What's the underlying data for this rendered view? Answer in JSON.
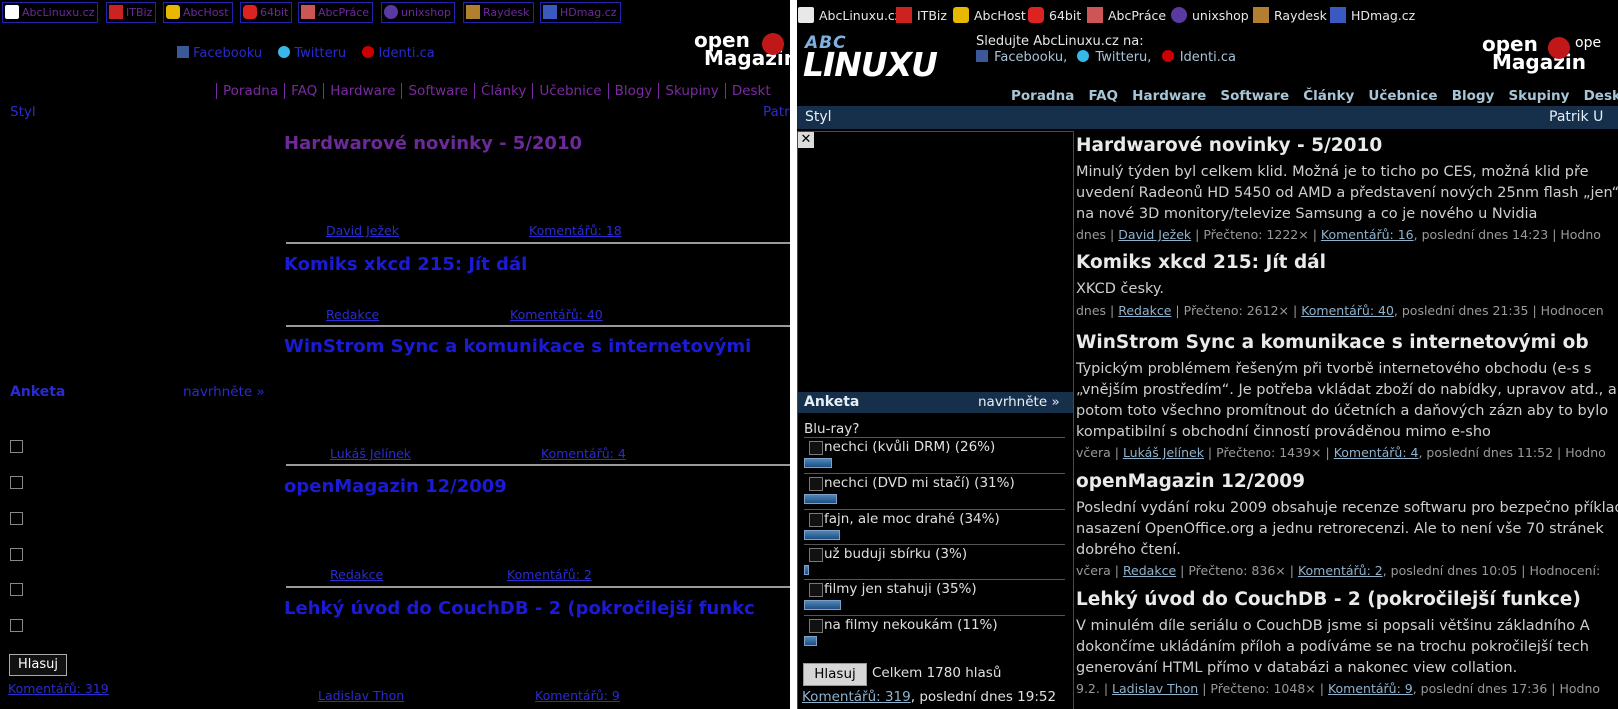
{
  "toolbar": [
    {
      "label": "AbcLinuxu.cz",
      "icon": "abclinuxu-icon"
    },
    {
      "label": "ITBiz",
      "icon": "itbiz-icon"
    },
    {
      "label": "AbcHost",
      "icon": "lock-icon"
    },
    {
      "label": "64bit",
      "icon": "64bit-icon"
    },
    {
      "label": "AbcPráce",
      "icon": "eraser-icon"
    },
    {
      "label": "unixshop",
      "icon": "unixshop-icon"
    },
    {
      "label": "Raydesk",
      "icon": "raydesk-icon"
    },
    {
      "label": "HDmag.cz",
      "icon": "hdmag-icon"
    }
  ],
  "header": {
    "follow_text": "Sledujte AbcLinuxu.cz na:",
    "facebook": "Facebooku,",
    "twitter": "Twitteru,",
    "identica": "Identi.ca",
    "facebook_left": "Facebooku",
    "twitter_left": "Twitteru",
    "openmag_line1": "open",
    "openmag_line2": "Magazin",
    "openmag_cut": "ope",
    "logo_abc": "ABC",
    "logo_linux": "LINUXU"
  },
  "menu": [
    "Poradna",
    "FAQ",
    "Hardware",
    "Software",
    "Články",
    "Učebnice",
    "Blogy",
    "Skupiny",
    "Desktopy"
  ],
  "menu_left_last": "Deskt",
  "stylbar": {
    "left": "Styl",
    "right": "Patrik U",
    "right_left": "Patr"
  },
  "poll": {
    "title": "Anketa",
    "suggest": "navrhněte »",
    "question": "Blu-ray?",
    "options": [
      {
        "label": "nechci (kvůli DRM) (26%)",
        "pct": 26
      },
      {
        "label": "nechci (DVD mi stačí) (31%)",
        "pct": 31
      },
      {
        "label": "fajn, ale moc drahé (34%)",
        "pct": 34
      },
      {
        "label": "už buduji sbírku (3%)",
        "pct": 3
      },
      {
        "label": "filmy jen stahuji (35%)",
        "pct": 35
      },
      {
        "label": "na filmy nekoukám (11%)",
        "pct": 11
      }
    ],
    "vote": "Hlasuj",
    "total": "Celkem 1780 hlasů",
    "comments": "Komentářů: 319",
    "last": ", poslední dnes 19:52"
  },
  "articles": [
    {
      "title": "Hardwarové novinky - 5/2010",
      "text": "Minulý týden byl celkem klid. Možná je to ticho po CES, možná klid pře uvedení Radeonů HD 5450 od AMD a představení nových 25nm flash „jen“ na nové 3D monitory/televize Samsung a co je nového u Nvidia",
      "date": "dnes",
      "author": "David Ježek",
      "read": "Přečteno: 1222×",
      "comments": "Komentářů: 16",
      "comments_left": "Komentářů: 18",
      "last": ", poslední dnes 14:23",
      "tail": "| Hodno"
    },
    {
      "title": "Komiks xkcd 215: Jít dál",
      "text": "XKCD česky.",
      "date": "dnes",
      "author": "Redakce",
      "read": "Přečteno: 2612×",
      "comments": "Komentářů: 40",
      "comments_left": "Komentářů: 40",
      "last": ", poslední dnes 21:35",
      "tail": "| Hodnocen"
    },
    {
      "title": "WinStrom Sync a komunikace s internetovými ob",
      "title_left": "WinStrom Sync a komunikace s internetovými",
      "text": "Typickým problémem řešeným při tvorbě internetového obchodu (e-s s „vnějším prostředím“. Je potřeba vkládat zboží do nabídky, upravov atd., a potom toto všechno promítnout do účetních a daňových zázn aby to bylo kompatibilní s obchodní činností prováděnou mimo e-sho",
      "date": "včera",
      "author": "Lukáš Jelínek",
      "read": "Přečteno: 1439×",
      "comments": "Komentářů: 4",
      "comments_left": "Komentářů: 4",
      "last": ", poslední dnes 11:52",
      "tail": "| Hodno"
    },
    {
      "title": "openMagazin 12/2009",
      "text": "Poslední vydání roku 2009 obsahuje recenze softwaru pro bezpečno příklady nasazení OpenOffice.org a jednu retrorecenzi. Ale to není vše 70 stránek dobrého čtení.",
      "date": "včera",
      "author": "Redakce",
      "read": "Přečteno: 836×",
      "comments": "Komentářů: 2",
      "comments_left": "Komentářů: 2",
      "last": ", poslední dnes 10:05",
      "tail": "| Hodnocení:"
    },
    {
      "title": "Lehký úvod do CouchDB - 2 (pokročilejší funkce)",
      "title_left": "Lehký úvod do CouchDB - 2 (pokročilejší funkc",
      "text": "V minulém díle seriálu o CouchDB jsme si popsali většinu základního A dokončíme ukládáním příloh a podíváme se na trochu pokročilejší tech generování HTML přímo v databázi a nakonec view collation.",
      "date": "9.2.",
      "author": "Ladislav Thon",
      "read": "Přečteno: 1048×",
      "comments": "Komentářů: 9",
      "comments_left": "Komentářů: 9",
      "last": ", poslední dnes 17:36",
      "tail": "| Hodno"
    }
  ],
  "colors": {
    "left_link": "#2b2bd0",
    "left_visited": "#6b2a98",
    "right_text": "#eaeaea",
    "right_link": "#8fb2cc",
    "stylbar": "#16304c"
  }
}
